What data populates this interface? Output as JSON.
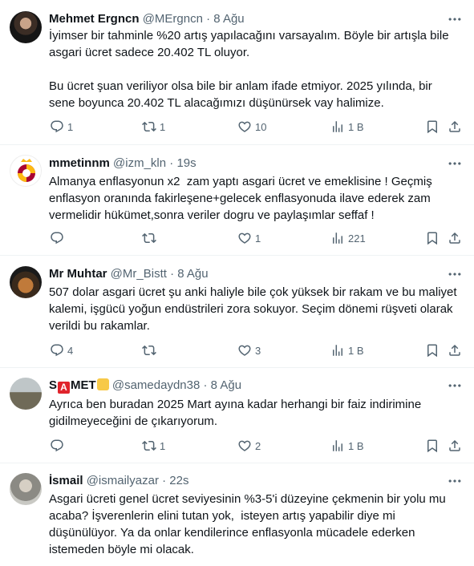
{
  "tweets": [
    {
      "name": "Mehmet Ergncn",
      "handle": "@MErgncn",
      "separator": "·",
      "time": "8 Ağu",
      "text": "İyimser bir tahminle %20 artış yapılacağını varsayalım. Böyle bir artışla bile asgari ücret sadece 20.402 TL oluyor.\n\nBu ücret şuan veriliyor olsa bile bir anlam ifade etmiyor. 2025 yılında, bir sene boyunca 20.402 TL alacağımızı düşünürsek vay halimize.",
      "replies": "1",
      "retweets": "1",
      "likes": "10",
      "views": "1 B"
    },
    {
      "name": "mmetinnm",
      "handle": "@izm_kln",
      "separator": "·",
      "time": "19s",
      "text": "Almanya enflasyonun x2  zam yaptı asgari ücret ve emeklisine ! Geçmiş enflasyon oranında fakirleşene+gelecek enflasyonuda ilave ederek zam vermelidir hükümet,sonra veriler dogru ve paylaşımlar seffaf !",
      "replies": "",
      "retweets": "",
      "likes": "1",
      "views": "221"
    },
    {
      "name": "Mr Muhtar",
      "handle": "@Mr_Bistt",
      "separator": "·",
      "time": "8 Ağu",
      "text": "507 dolar asgari ücret şu anki haliyle bile çok yüksek bir rakam ve bu maliyet kalemi, işgücü yoğun endüstrileri zora sokuyor. Seçim dönemi rüşveti olarak verildi bu rakamlar.",
      "replies": "4",
      "retweets": "",
      "likes": "3",
      "views": "1 B"
    },
    {
      "name_pre": "S",
      "name_box": "A",
      "name_post": "MET",
      "handle": "@samedaydn38",
      "separator": "·",
      "time": "8 Ağu",
      "text": "Ayrıca ben buradan 2025 Mart ayına kadar herhangi bir faiz indirimine gidilmeyeceğini de çıkarıyorum.",
      "replies": "",
      "retweets": "1",
      "likes": "2",
      "views": "1 B"
    },
    {
      "name": "İsmail",
      "handle": "@ismailyazar",
      "separator": "·",
      "time": "22s",
      "text": "Asgari ücreti genel ücret seviyesinin %3-5'i düzeyine çekmenin bir yolu mu acaba? İşverenlerin elini tutan yok,  isteyen artış yapabilir diye mi düşünülüyor. Ya da onlar kendilerince enflasyonla mücadele ederken istemeden böyle mi olacak."
    }
  ],
  "colors": {
    "text": "#0f1419",
    "secondary": "#536471",
    "divider": "#eff3f4"
  }
}
